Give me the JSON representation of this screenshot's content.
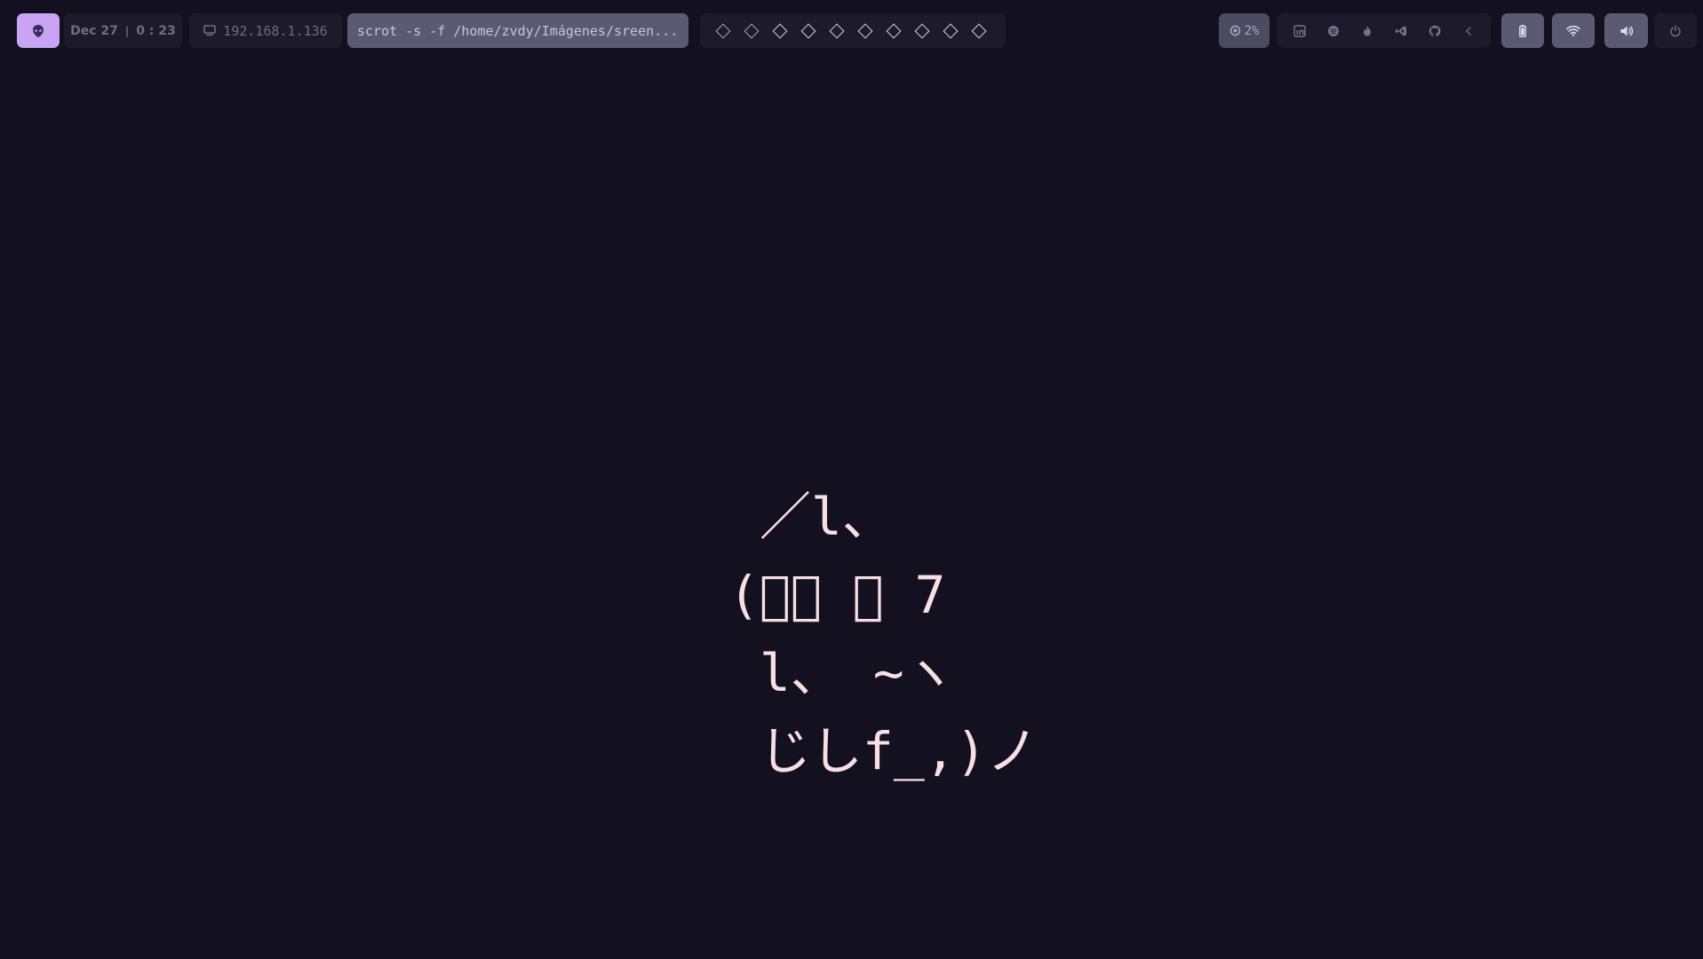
{
  "topbar": {
    "launcher": {
      "icon": "alien-icon"
    },
    "clock": {
      "date": "Dec 27",
      "separator": "|",
      "time": "0 : 23"
    },
    "network": {
      "icon": "monitor-icon",
      "ip": "192.168.1.136"
    },
    "active_window": {
      "title": "scrot -s -f /home/zvdy/Imágenes/sreen..."
    },
    "workspaces": {
      "count": 10,
      "active_indices": [
        2,
        3,
        4,
        5,
        6,
        7,
        8,
        9
      ]
    },
    "cpu": {
      "icon": "cpu-icon",
      "value": "2%"
    },
    "apps": [
      {
        "name": "linkedin",
        "icon": "linkedin-icon"
      },
      {
        "name": "spotify",
        "icon": "spotify-icon"
      },
      {
        "name": "fire",
        "icon": "fire-icon"
      },
      {
        "name": "vscode",
        "icon": "vscode-icon"
      },
      {
        "name": "github",
        "icon": "github-icon"
      },
      {
        "name": "collapse",
        "icon": "chevron-left-icon"
      }
    ],
    "battery": {
      "icon": "battery-icon"
    },
    "wifi": {
      "icon": "wifi-icon"
    },
    "volume": {
      "icon": "volume-icon"
    },
    "power": {
      "icon": "power-icon"
    }
  },
  "desktop": {
    "ascii_art": " ／l、\n(ﾟ､ ｡ 7\n l、 ~ヽ\n じしf_,)ノ"
  },
  "colors": {
    "background": "#13111f",
    "pill": "#1d1b2b",
    "pill_active": "#5b5a73",
    "accent": "#c9a4f4",
    "art": "#f7dfe3"
  }
}
